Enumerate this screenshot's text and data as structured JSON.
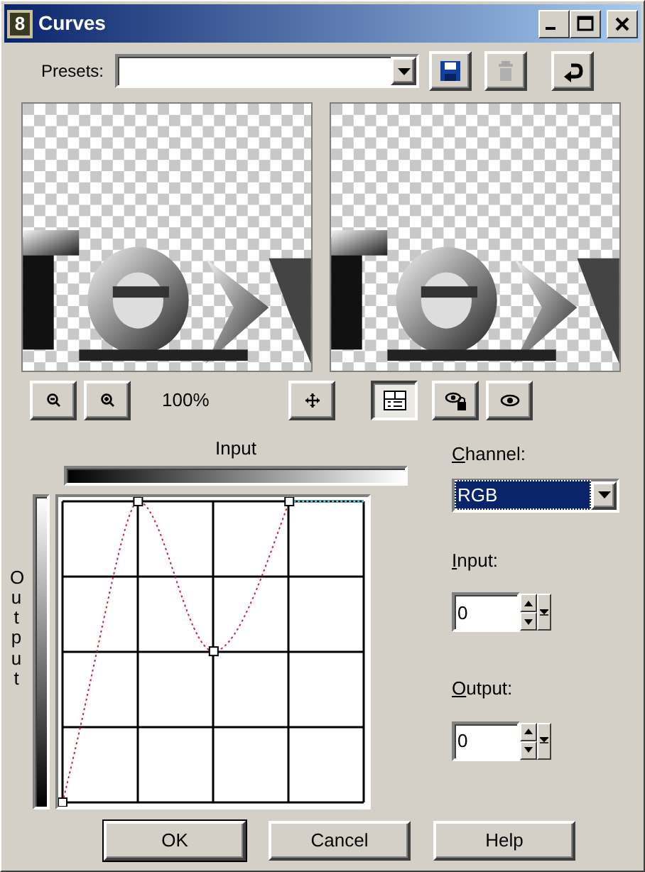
{
  "window": {
    "title": "Curves",
    "icon_label": "8"
  },
  "presets": {
    "label": "Presets:"
  },
  "view": {
    "zoom_reading": "100%",
    "split_view_pressed": true
  },
  "curve": {
    "input_label": "Input",
    "output_label": "Output"
  },
  "channel": {
    "label": "Channel:",
    "value": "RGB",
    "focused": true
  },
  "input": {
    "label": "Input:",
    "value": "0"
  },
  "output": {
    "label": "Output:",
    "value": "0"
  },
  "buttons": [
    {
      "label": "OK",
      "default": true
    },
    {
      "label": "Cancel",
      "default": false
    },
    {
      "label": "Help",
      "default": false
    }
  ]
}
